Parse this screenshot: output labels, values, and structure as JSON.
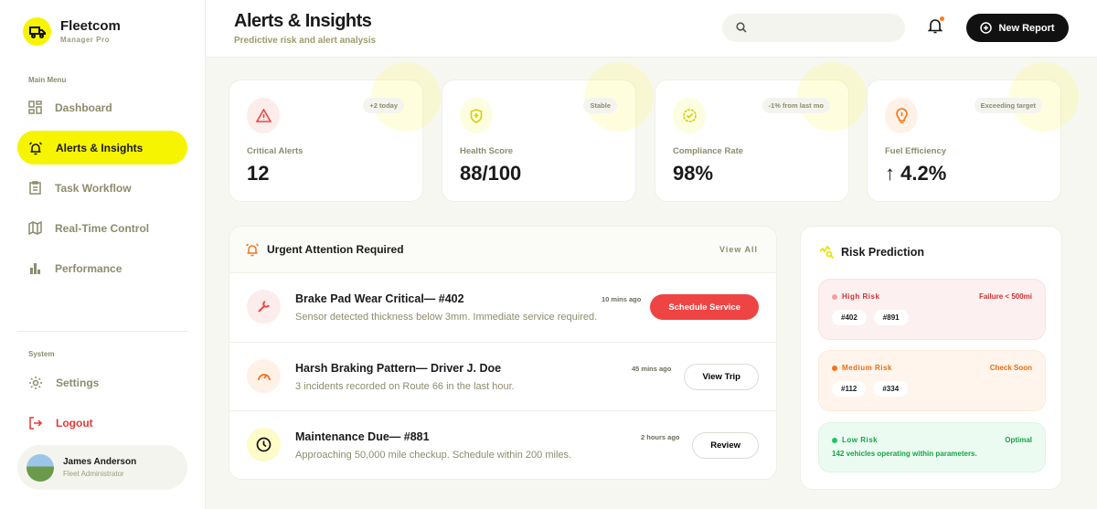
{
  "brand": {
    "name": "Fleetcom",
    "sub": "Manager Pro"
  },
  "sidebar": {
    "main_label": "Main Menu",
    "items": [
      {
        "label": "Dashboard",
        "icon": "grid-icon"
      },
      {
        "label": "Alerts & Insights",
        "icon": "alarm-icon",
        "active": true
      },
      {
        "label": "Task Workflow",
        "icon": "clipboard-icon"
      },
      {
        "label": "Real-Time Control",
        "icon": "map-icon"
      },
      {
        "label": "Performance",
        "icon": "bar-chart-icon"
      }
    ],
    "system_label": "System",
    "settings": "Settings",
    "logout": "Logout",
    "user": {
      "name": "James Anderson",
      "role": "Fleet Administrator"
    }
  },
  "header": {
    "title": "Alerts & Insights",
    "subtitle": "Predictive risk and alert analysis",
    "search_placeholder": "",
    "new_report": "New Report"
  },
  "stats": [
    {
      "label": "Critical Alerts",
      "value": "12",
      "badge": "+2 today",
      "icon": "warning-icon",
      "color": "#ef4444"
    },
    {
      "label": "Health Score",
      "value": "88/100",
      "badge": "Stable",
      "icon": "shield-plus-icon",
      "color": "#d4d000"
    },
    {
      "label": "Compliance Rate",
      "value": "98%",
      "badge": "-1% from last mo",
      "icon": "badge-check-icon",
      "color": "#d4d000"
    },
    {
      "label": "Fuel Efficiency",
      "value": "↑ 4.2%",
      "badge": "Exceeding target",
      "icon": "fuel-icon",
      "color": "#f97316"
    }
  ],
  "urgent": {
    "title": "Urgent Attention Required",
    "view_all": "View All",
    "items": [
      {
        "title": "Brake Pad Wear Critical— #402",
        "desc": "Sensor detected thickness below 3mm. Immediate service required.",
        "time": "10 mins ago",
        "action": "Schedule Service"
      },
      {
        "title": "Harsh Braking Pattern— Driver J. Doe",
        "desc": "3 incidents recorded on Route 66 in the last hour.",
        "time": "45 mins ago",
        "action": "View Trip"
      },
      {
        "title": "Maintenance Due— #881",
        "desc": "Approaching 50,000 mile checkup. Schedule within 200 miles.",
        "time": "2 hours ago",
        "action": "Review"
      }
    ]
  },
  "risk": {
    "title": "Risk Prediction",
    "high": {
      "label": "High Risk",
      "status": "Failure < 500mi",
      "vehicles": [
        "#402",
        "#891"
      ]
    },
    "medium": {
      "label": "Medium Risk",
      "status": "Check Soon",
      "vehicles": [
        "#112",
        "#334"
      ]
    },
    "low": {
      "label": "Low Risk",
      "status": "Optimal",
      "desc": "142 vehicles operating within parameters."
    }
  },
  "colors": {
    "accent": "#f6f400",
    "danger": "#ef4444",
    "warning": "#f97316",
    "success": "#22c55e"
  }
}
